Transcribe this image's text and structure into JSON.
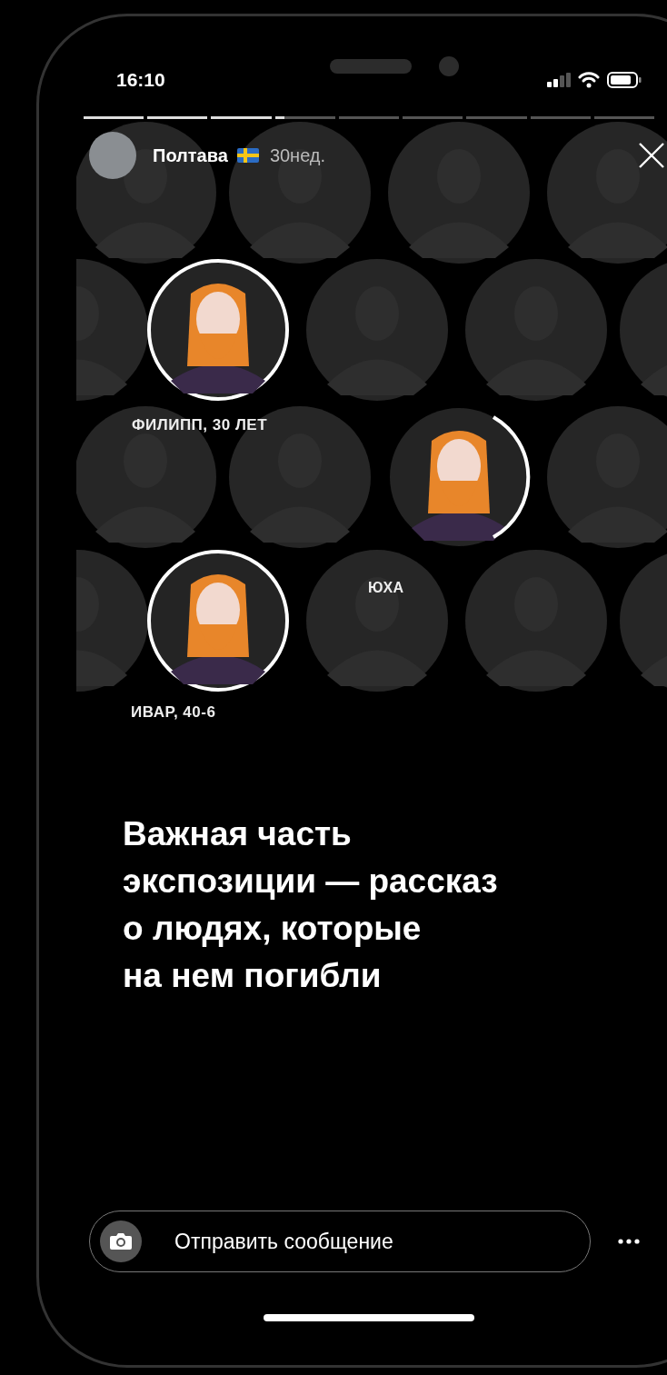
{
  "status_bar": {
    "time": "16:10"
  },
  "story": {
    "progress": [
      {
        "level": 1
      },
      {
        "level": 1
      },
      {
        "level": 1
      },
      {
        "level": 0.15
      },
      {
        "level": 0
      },
      {
        "level": 0
      },
      {
        "level": 0
      },
      {
        "level": 0
      },
      {
        "level": 0
      }
    ],
    "account": {
      "name": "Полтава",
      "time_ago": "30нед."
    },
    "labels": [
      "ФИЛИПП, 30 ЛЕТ",
      "ЮХА",
      "ИВАР, 40-6"
    ],
    "caption_lines": [
      "Важная часть",
      "экспозиции — рассказ",
      "о людях, которые",
      "на нем погибли"
    ]
  },
  "reply": {
    "placeholder": "Отправить сообщение"
  }
}
